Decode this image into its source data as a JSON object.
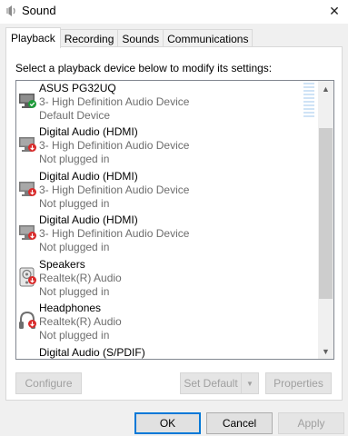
{
  "window": {
    "title": "Sound",
    "close_glyph": "✕"
  },
  "tabs": [
    {
      "label": "Playback",
      "active": true
    },
    {
      "label": "Recording",
      "active": false
    },
    {
      "label": "Sounds",
      "active": false
    },
    {
      "label": "Communications",
      "active": false
    }
  ],
  "instruction": "Select a playback device below to modify its settings:",
  "devices": [
    {
      "name": "ASUS PG32UQ",
      "description": "3- High Definition Audio Device",
      "status": "Default Device",
      "icon": "monitor-icon",
      "badge": "green-check"
    },
    {
      "name": "Digital Audio (HDMI)",
      "description": "3- High Definition Audio Device",
      "status": "Not plugged in",
      "icon": "monitor-icon",
      "badge": "red-down-arrow"
    },
    {
      "name": "Digital Audio (HDMI)",
      "description": "3- High Definition Audio Device",
      "status": "Not plugged in",
      "icon": "monitor-icon",
      "badge": "red-down-arrow"
    },
    {
      "name": "Digital Audio (HDMI)",
      "description": "3- High Definition Audio Device",
      "status": "Not plugged in",
      "icon": "monitor-icon",
      "badge": "red-down-arrow"
    },
    {
      "name": "Speakers",
      "description": "Realtek(R) Audio",
      "status": "Not plugged in",
      "icon": "speaker-icon",
      "badge": "red-down-arrow"
    },
    {
      "name": "Headphones",
      "description": "Realtek(R) Audio",
      "status": "Not plugged in",
      "icon": "headphones-icon",
      "badge": "red-down-arrow"
    },
    {
      "name": "Digital Audio (S/PDIF)",
      "description": "",
      "status": "",
      "icon": "",
      "badge": ""
    }
  ],
  "buttons": {
    "configure": "Configure",
    "set_default": "Set Default",
    "properties": "Properties",
    "ok": "OK",
    "cancel": "Cancel",
    "apply": "Apply"
  },
  "colors": {
    "accent": "#0078d7",
    "check_green": "#1e9b3a",
    "unplugged_red": "#d92b2b",
    "level_meter": "#cfe3f6"
  }
}
